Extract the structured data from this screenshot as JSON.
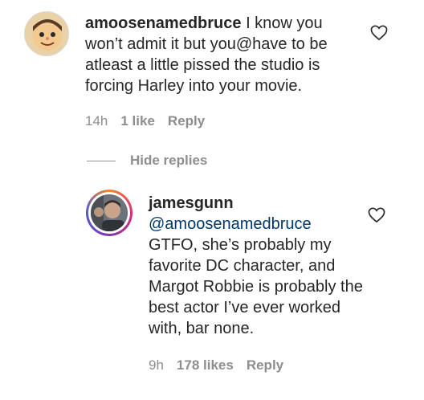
{
  "comment1": {
    "username": "amoosenamedbruce",
    "text": " I know you won’t admit it but you@have to be atleast a little pissed the studio is forcing Harley into your movie.",
    "time": "14h",
    "likes": "1 like",
    "reply": "Reply"
  },
  "hide_replies": "Hide replies",
  "comment2": {
    "username": "jamesgunn",
    "mention": "@amoosenamedbruce",
    "text": "GTFO, she’s probably my favorite DC character, and Margot Robbie is probably the best actor I’ve ever worked with, bar none.",
    "time": "9h",
    "likes": "178 likes",
    "reply": "Reply"
  },
  "colors": {
    "text": "#262626",
    "muted": "#8e8e8e",
    "mention": "#00376b"
  },
  "icons": [
    "heart-icon",
    "heart-icon"
  ]
}
